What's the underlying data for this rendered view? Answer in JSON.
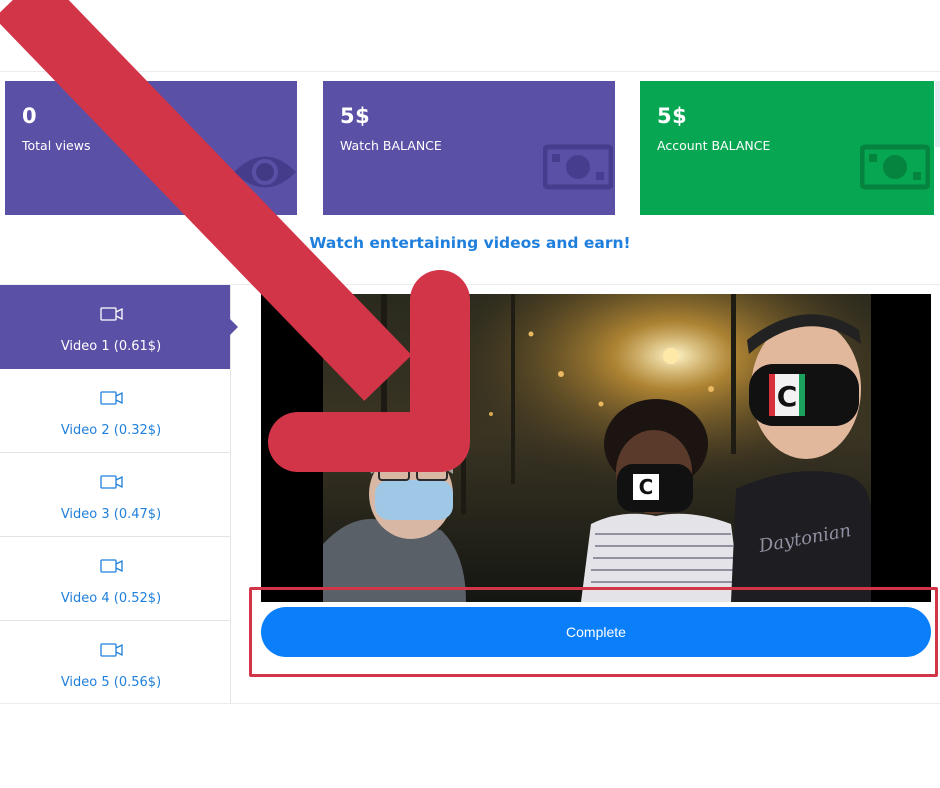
{
  "stats": [
    {
      "value": "0",
      "label": "Total views",
      "icon": "eye-icon",
      "color": "#5a50a6"
    },
    {
      "value": "5$",
      "label": "Watch BALANCE",
      "icon": "banknote-icon",
      "color": "#5a50a6"
    },
    {
      "value": "5$",
      "label": "Account BALANCE",
      "icon": "banknote-icon",
      "color": "#07a652"
    }
  ],
  "headline": "Watch entertaining videos and earn!",
  "videos": [
    {
      "label": "Video 1 (0.61$)",
      "active": true,
      "icon": "video-camera-icon"
    },
    {
      "label": "Video 2 (0.32$)",
      "active": false,
      "icon": "video-camera-icon"
    },
    {
      "label": "Video 3 (0.47$)",
      "active": false,
      "icon": "video-camera-icon"
    },
    {
      "label": "Video 4 (0.52$)",
      "active": false,
      "icon": "video-camera-icon"
    },
    {
      "label": "Video 5 (0.56$)",
      "active": false,
      "icon": "video-camera-icon"
    }
  ],
  "player": {
    "mask_logo_letter": "C",
    "shirt_text": "Daytonian"
  },
  "complete_button": {
    "label": "Complete",
    "color": "#0a7ff9"
  },
  "annotation": {
    "arrow_color": "#d23448",
    "highlight_color": "#d23448"
  }
}
